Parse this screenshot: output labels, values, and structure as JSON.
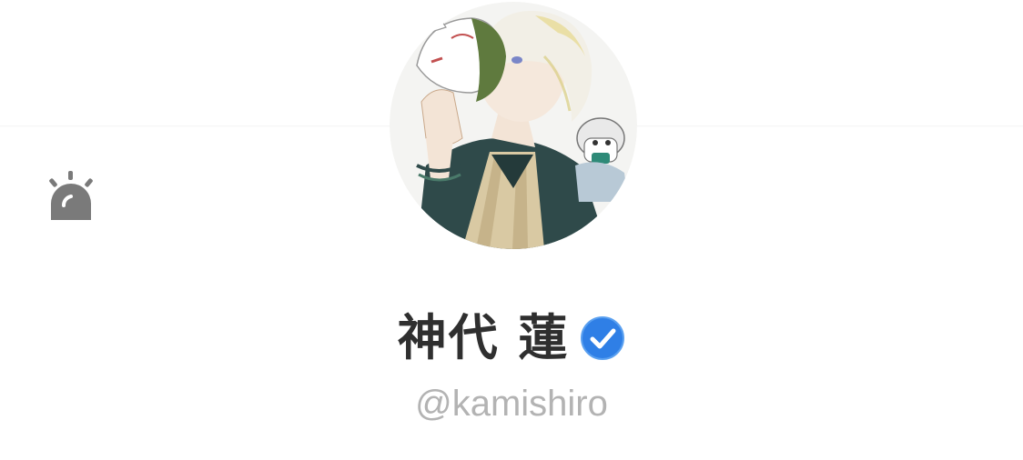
{
  "toolbar": {
    "alert_icon": "siren-icon"
  },
  "profile": {
    "avatar_icon": "avatar-illustration",
    "display_name": "神代 蓮",
    "verified_icon": "verified-check-icon",
    "handle": "@kamishiro"
  },
  "colors": {
    "background": "#ffffff",
    "name": "#2f2f2f",
    "handle": "#b3b3b3",
    "verified": "#2f7fe6",
    "alert_icon": "#7a7a7a"
  }
}
